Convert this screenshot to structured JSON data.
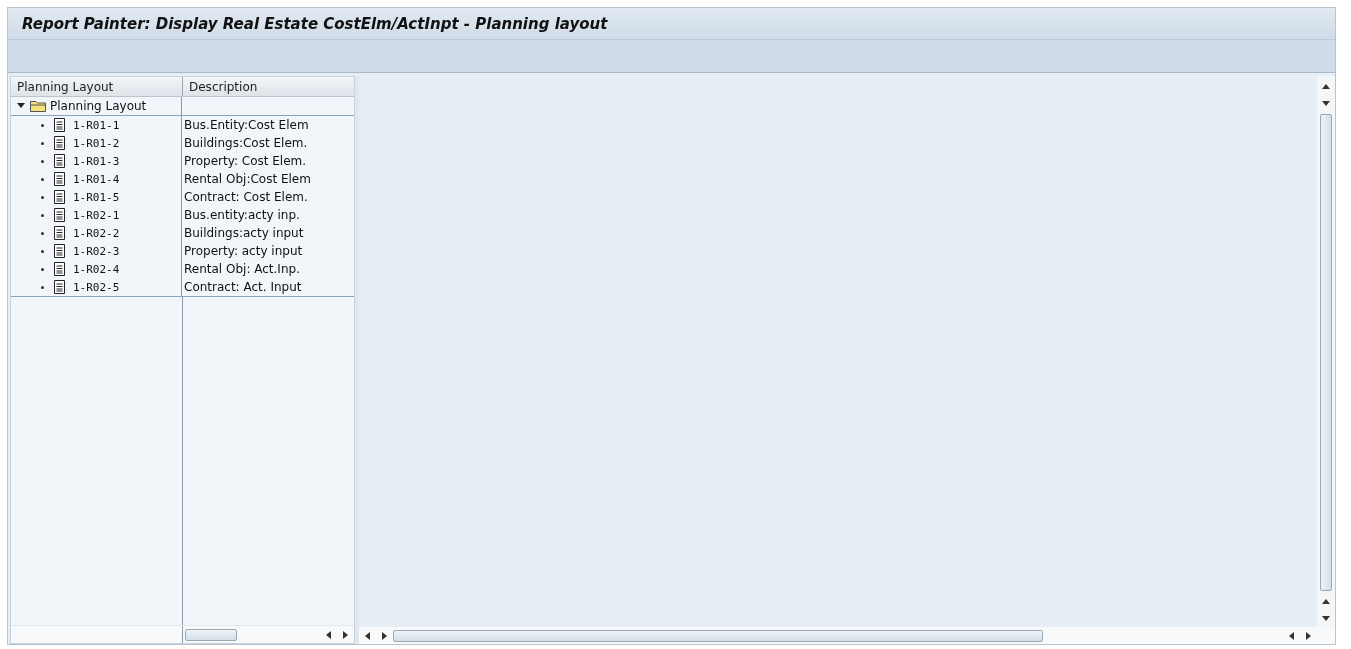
{
  "window": {
    "title": "Report Painter: Display Real Estate CostElm/ActInpt - Planning layout"
  },
  "tree": {
    "columns": [
      "Planning Layout",
      "Description"
    ],
    "nodes": [
      {
        "label": "Planning Layout",
        "expanded": true,
        "children": [
          {
            "label": "1-R01-1",
            "description": "Bus.Entity:Cost Elem"
          },
          {
            "label": "1-R01-2",
            "description": "Buildings:Cost Elem."
          },
          {
            "label": "1-R01-3",
            "description": "Property: Cost Elem."
          },
          {
            "label": "1-R01-4",
            "description": "Rental Obj:Cost Elem"
          },
          {
            "label": "1-R01-5",
            "description": "Contract: Cost Elem."
          },
          {
            "label": "1-R02-1",
            "description": "Bus.entity:acty inp."
          },
          {
            "label": "1-R02-2",
            "description": "Buildings:acty input"
          },
          {
            "label": "1-R02-3",
            "description": "Property: acty input"
          },
          {
            "label": "1-R02-4",
            "description": "Rental Obj: Act.Inp."
          },
          {
            "label": "1-R02-5",
            "description": "Contract: Act. Input"
          }
        ]
      }
    ]
  }
}
